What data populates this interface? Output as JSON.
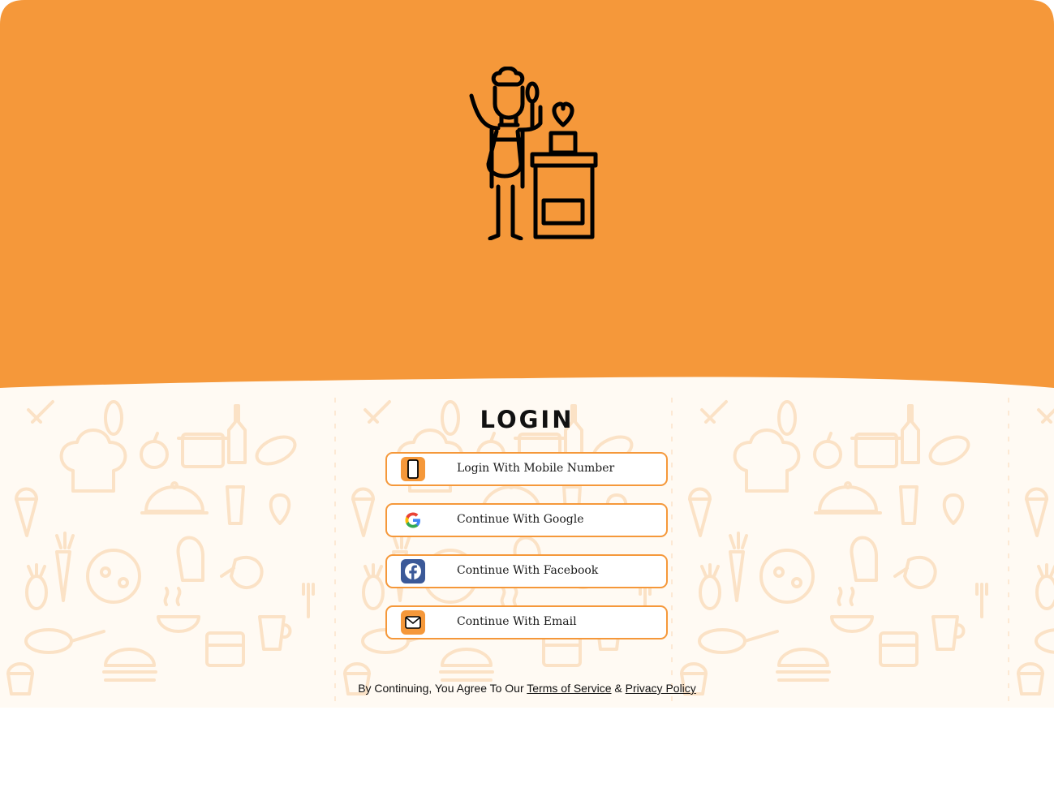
{
  "colors": {
    "brand_orange": "#f5983a",
    "pattern_stroke": "#fbe2c6",
    "text_dark": "#111111"
  },
  "hero": {
    "illustration": "chef-cooking-icon"
  },
  "login": {
    "title": "LOGIN",
    "buttons": [
      {
        "label": "Login With Mobile Number",
        "icon": "mobile-phone-icon"
      },
      {
        "label": "Continue With Google",
        "icon": "google-icon"
      },
      {
        "label": "Continue With Facebook",
        "icon": "facebook-icon"
      },
      {
        "label": "Continue With Email",
        "icon": "email-icon"
      }
    ]
  },
  "footer": {
    "prefix": "By Continuing, You Agree To Our",
    "terms_link": "Terms of Service",
    "ampersand": "&",
    "privacy_link": "Privacy Policy"
  }
}
